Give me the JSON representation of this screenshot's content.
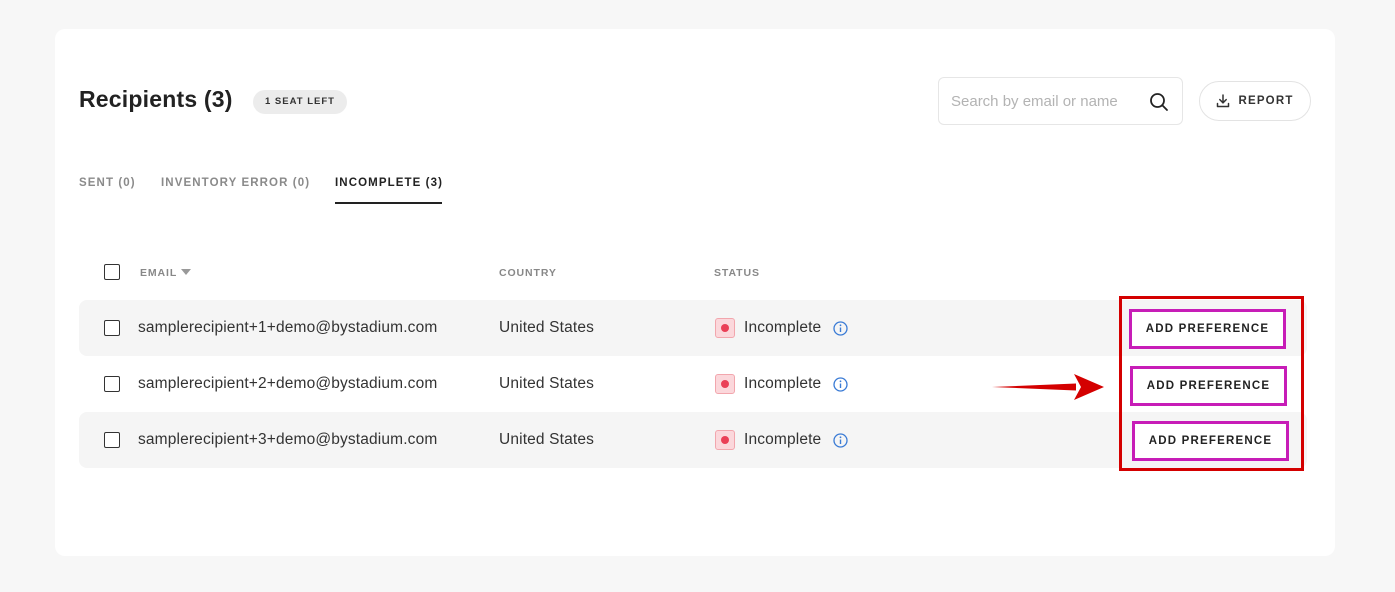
{
  "header": {
    "title": "Recipients (3)",
    "seat_badge": "1 SEAT LEFT",
    "search_placeholder": "Search by email or name",
    "search_value": "",
    "report_label": "REPORT"
  },
  "tabs": [
    {
      "label": "SENT (0)",
      "active": false
    },
    {
      "label": "INVENTORY ERROR (0)",
      "active": false
    },
    {
      "label": "INCOMPLETE (3)",
      "active": true
    }
  ],
  "table": {
    "columns": {
      "email": "EMAIL",
      "country": "COUNTRY",
      "status": "STATUS"
    },
    "sort_column": "email",
    "rows": [
      {
        "email": "samplerecipient+1+demo@bystadium.com",
        "country": "United States",
        "status": "Incomplete",
        "action": "ADD PREFERENCE"
      },
      {
        "email": "samplerecipient+2+demo@bystadium.com",
        "country": "United States",
        "status": "Incomplete",
        "action": "ADD PREFERENCE"
      },
      {
        "email": "samplerecipient+3+demo@bystadium.com",
        "country": "United States",
        "status": "Incomplete",
        "action": "ADD PREFERENCE"
      }
    ]
  },
  "icons": {
    "search": "search-icon",
    "report": "download-icon",
    "status_info": "info-icon",
    "annotation": "red-arrow"
  },
  "colors": {
    "status_incomplete": "#ea3f56",
    "info_icon": "#3a7bd5",
    "annotation_box": "#d40000",
    "button_highlight": "#c71db7"
  }
}
